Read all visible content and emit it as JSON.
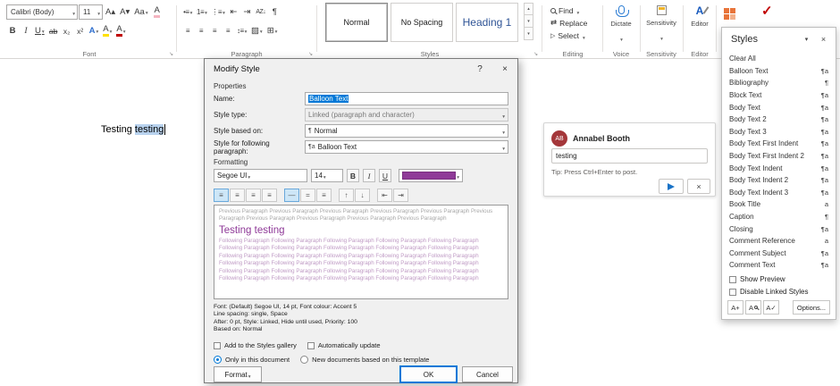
{
  "colors": {
    "accent_purple": "#8f3a98",
    "selection_blue": "#0078d7",
    "selection_light": "#b8d2ee",
    "avatar_red": "#a4373a",
    "send_blue": "#1a73c7",
    "check_red": "#c00000",
    "heading_blue": "#2f5496",
    "editor_blue": "#185abd",
    "addin_orange": "#e8743a",
    "mic_blue": "#2b7cd3",
    "highlight_yellow": "#ffe100"
  },
  "icons": {
    "grow_font": "A▴",
    "shrink_font": "A▾",
    "change_case": "Aa",
    "clear_formatting": "A",
    "bold": "B",
    "italic": "I",
    "underline": "U",
    "strikethrough": "ab",
    "subscript": "x₂",
    "superscript": "x²",
    "text_effects": "A",
    "text_highlight": "A",
    "font_color": "A",
    "bullets": "•≡",
    "numbering": "1≡",
    "multilevel_list": "⋮≡",
    "decrease_indent": "⇤",
    "increase_indent": "⇥",
    "sort": "AZ↓",
    "pilcrow": "¶",
    "align": "≡",
    "line_spacing": "↕≡",
    "shading": "▨",
    "borders": "⊞",
    "replace": "⇄",
    "select": "▷",
    "addin_check": "✓",
    "spacing_single": "—",
    "spacing_15": "=",
    "spacing_double": "≡",
    "space_up": "↑",
    "space_down": "↓",
    "help": "?",
    "close": "×",
    "new_style": "A+",
    "style_inspector": "A",
    "manage_styles": "A✓"
  },
  "ribbon": {
    "font_name": "Calibri (Body)",
    "font_size": "11",
    "groups": {
      "font": "Font",
      "paragraph": "Paragraph",
      "styles": "Styles",
      "editing": "Editing",
      "voice": "Voice",
      "sensitivity": "Sensitivity",
      "editor": "Editor"
    },
    "gallery": [
      {
        "label": "Normal"
      },
      {
        "label": "No Spacing"
      },
      {
        "label": "Heading 1"
      }
    ],
    "editing": {
      "find": "Find",
      "replace": "Replace",
      "select": "Select"
    },
    "voice": {
      "dictate": "Dictate"
    },
    "sensitivity_label": "Sensitivity",
    "editor_label": "Editor"
  },
  "document": {
    "text_before": "Testing ",
    "text_selected": "testing"
  },
  "dialog": {
    "title": "Modify Style",
    "properties_label": "Properties",
    "name_label": "Name:",
    "name_value": "Balloon Text",
    "style_type_label": "Style type:",
    "style_type_value": "Linked (paragraph and character)",
    "based_on_label": "Style based on:",
    "based_on_marker": "¶",
    "based_on_value": "Normal",
    "following_label": "Style for following paragraph:",
    "following_marker": "¶a",
    "following_value": "Balloon Text",
    "formatting_label": "Formatting",
    "font_name": "Segoe UI",
    "font_size": "14",
    "preview_previous": "Previous Paragraph Previous Paragraph Previous Paragraph Previous Paragraph Previous Paragraph Previous Paragraph Previous Paragraph Previous Paragraph Previous Paragraph Previous Paragraph",
    "preview_sample": "Testing testing",
    "preview_following": "Following Paragraph Following Paragraph Following Paragraph Following Paragraph Following Paragraph Following Paragraph Following Paragraph Following Paragraph Following Paragraph Following Paragraph Following Paragraph Following Paragraph Following Paragraph Following Paragraph Following Paragraph Following Paragraph Following Paragraph Following Paragraph Following Paragraph Following Paragraph Following Paragraph Following Paragraph Following Paragraph Following Paragraph Following Paragraph Following Paragraph Following Paragraph Following Paragraph Following Paragraph Following Paragraph",
    "description_lines": [
      "Font: (Default) Segoe UI, 14 pt, Font colour: Accent 5",
      "Line spacing:  single, Space",
      "After:  0 pt, Style: Linked, Hide until used, Priority: 100",
      "Based on: Normal"
    ],
    "add_to_gallery_label": "Add to the Styles gallery",
    "auto_update_label": "Automatically update",
    "only_in_doc_label": "Only in this document",
    "new_docs_label": "New documents based on this template",
    "format_button": "Format",
    "ok_button": "OK",
    "cancel_button": "Cancel"
  },
  "comment": {
    "initials": "AB",
    "author": "Annabel Booth",
    "input_value": "testing",
    "tip": "Tip: Press Ctrl+Enter to post."
  },
  "styles_pane": {
    "title": "Styles",
    "items": [
      {
        "label": "Clear All",
        "marker": ""
      },
      {
        "label": "Balloon Text",
        "marker": "¶a"
      },
      {
        "label": "Bibliography",
        "marker": "¶"
      },
      {
        "label": "Block Text",
        "marker": "¶a"
      },
      {
        "label": "Body Text",
        "marker": "¶a"
      },
      {
        "label": "Body Text 2",
        "marker": "¶a"
      },
      {
        "label": "Body Text 3",
        "marker": "¶a"
      },
      {
        "label": "Body Text First Indent",
        "marker": "¶a"
      },
      {
        "label": "Body Text First Indent 2",
        "marker": "¶a"
      },
      {
        "label": "Body Text Indent",
        "marker": "¶a"
      },
      {
        "label": "Body Text Indent 2",
        "marker": "¶a"
      },
      {
        "label": "Body Text Indent 3",
        "marker": "¶a"
      },
      {
        "label": "Book Title",
        "marker": "a"
      },
      {
        "label": "Caption",
        "marker": "¶"
      },
      {
        "label": "Closing",
        "marker": "¶a"
      },
      {
        "label": "Comment Reference",
        "marker": "a"
      },
      {
        "label": "Comment Subject",
        "marker": "¶a"
      },
      {
        "label": "Comment Text",
        "marker": "¶a"
      }
    ],
    "show_preview_label": "Show Preview",
    "disable_linked_label": "Disable Linked Styles",
    "options_button": "Options..."
  }
}
